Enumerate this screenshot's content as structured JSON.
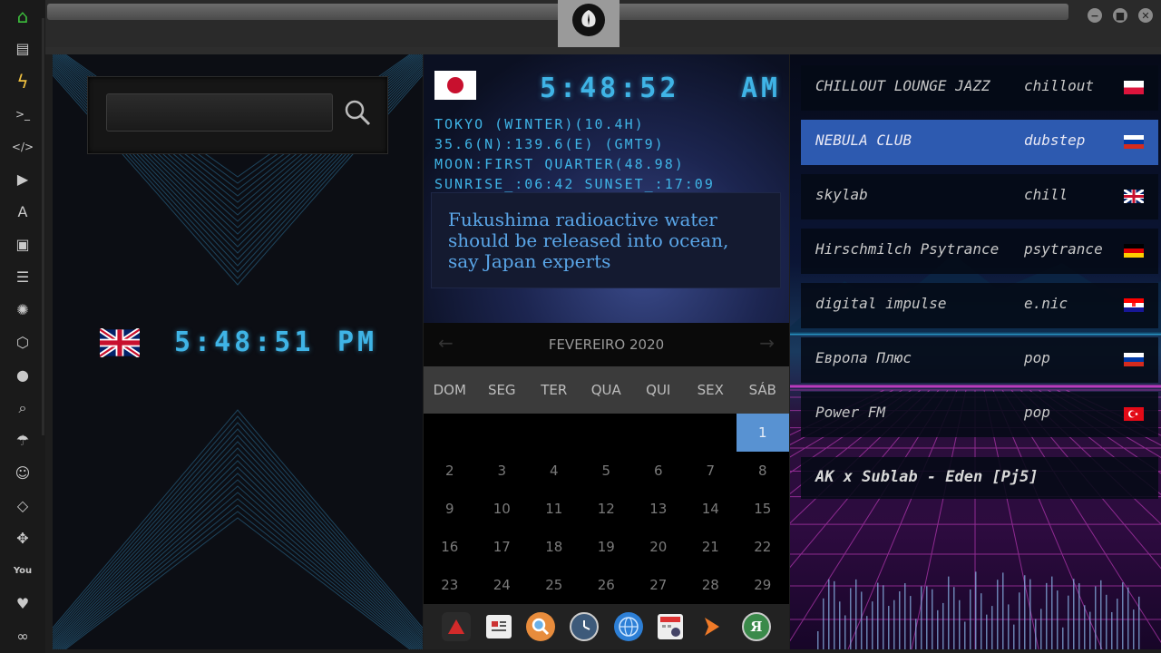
{
  "search": {
    "placeholder": ""
  },
  "clock_uk": {
    "time": "5:48:51",
    "ampm": "PM"
  },
  "clock_jp": {
    "time": "5:48:52",
    "ampm": "AM",
    "lines": [
      "TOKYO (WINTER)(10.4H)",
      "35.6(N):139.6(E) (GMT9)",
      "MOON:FIRST QUARTER(48.98)",
      "SUNRISE_:06:42 SUNSET_:17:09"
    ]
  },
  "news": {
    "headline": "Fukushima radioactive water should be released into ocean, say Japan experts"
  },
  "calendar": {
    "month_label": "FEVEREIRO 2020",
    "prev": "←",
    "next": "→",
    "day_names": [
      "DOM",
      "SEG",
      "TER",
      "QUA",
      "QUI",
      "SEX",
      "SÁB"
    ],
    "weeks": [
      [
        "",
        "",
        "",
        "",
        "",
        "",
        "1"
      ],
      [
        "2",
        "3",
        "4",
        "5",
        "6",
        "7",
        "8"
      ],
      [
        "9",
        "10",
        "11",
        "12",
        "13",
        "14",
        "15"
      ],
      [
        "16",
        "17",
        "18",
        "19",
        "20",
        "21",
        "22"
      ],
      [
        "23",
        "24",
        "25",
        "26",
        "27",
        "28",
        "29"
      ]
    ],
    "today": "1"
  },
  "stations": [
    {
      "name": "CHILLOUT LOUNGE JAZZ",
      "genre": "chillout",
      "flag": "poland",
      "active": false
    },
    {
      "name": "NEBULA CLUB",
      "genre": "dubstep",
      "flag": "russia",
      "active": true
    },
    {
      "name": "skylab",
      "genre": "chill",
      "flag": "uk",
      "active": false
    },
    {
      "name": "Hirschmilch Psytrance",
      "genre": "psytrance",
      "flag": "germany",
      "active": false
    },
    {
      "name": "digital impulse",
      "genre": "e.nic",
      "flag": "croatia",
      "active": false
    },
    {
      "name": "Европа Плюс",
      "genre": "pop",
      "flag": "russia",
      "active": false
    },
    {
      "name": "Power FM",
      "genre": "pop",
      "flag": "turkey",
      "active": false
    }
  ],
  "now_playing": "AK x Sublab - Eden [Pj5]",
  "sidebar_icons": [
    "home-icon",
    "document-icon",
    "lightning-icon",
    "terminal-icon",
    "code-icon",
    "play-icon",
    "translate-icon",
    "image-icon",
    "news-icon",
    "aperture-icon",
    "hexagon-icon",
    "globe-icon",
    "search-icon",
    "umbrella-icon",
    "contacts-icon",
    "tag-icon",
    "expand-icon",
    "youtube-icon",
    "heart-icon",
    "infinity-icon"
  ],
  "dock_icons": [
    "vivaldi-icon",
    "newspaper-icon",
    "search-app-icon",
    "clock-app-icon",
    "web-browser-icon",
    "calendar-app-icon",
    "arrow-app-icon",
    "yandex-icon"
  ],
  "colors": {
    "accent": "#3fb4e6",
    "active_station": "#2d5ab0",
    "today": "#5892d2",
    "home_icon": "#3cbf3c"
  }
}
